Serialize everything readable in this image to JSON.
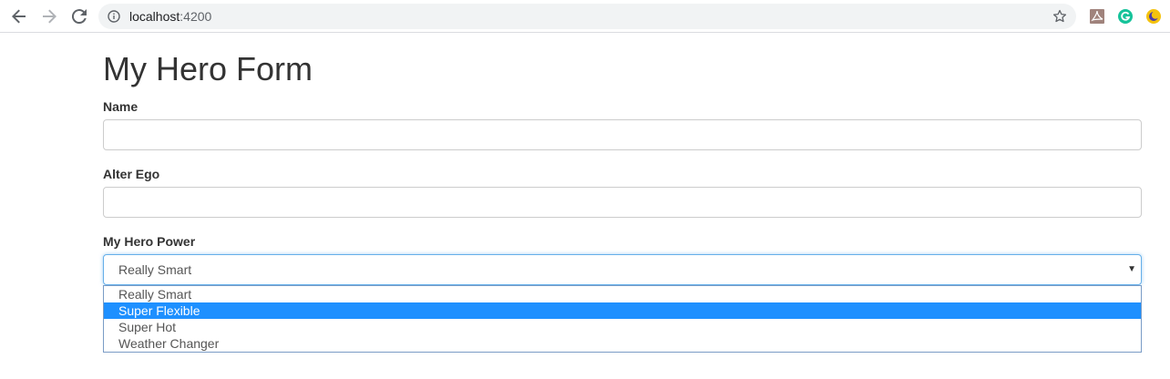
{
  "browser": {
    "url_host": "localhost",
    "url_port": ":4200",
    "icons": [
      "back-arrow-icon",
      "forward-arrow-icon",
      "reload-icon",
      "info-icon",
      "bookmark-star-icon",
      "pdf-extension-icon",
      "grammarly-extension-icon",
      "moon-extension-icon"
    ]
  },
  "form": {
    "title": "My Hero Form",
    "name_label": "Name",
    "name_value": "",
    "alter_ego_label": "Alter Ego",
    "alter_ego_value": "",
    "power_label": "My Hero Power",
    "power_selected": "Really Smart",
    "power_options": [
      "Really Smart",
      "Super Flexible",
      "Super Hot",
      "Weather Changer"
    ],
    "highlighted_option": "Super Flexible"
  },
  "colors": {
    "highlight": "#1e90ff",
    "focus_border": "#66afe9"
  }
}
